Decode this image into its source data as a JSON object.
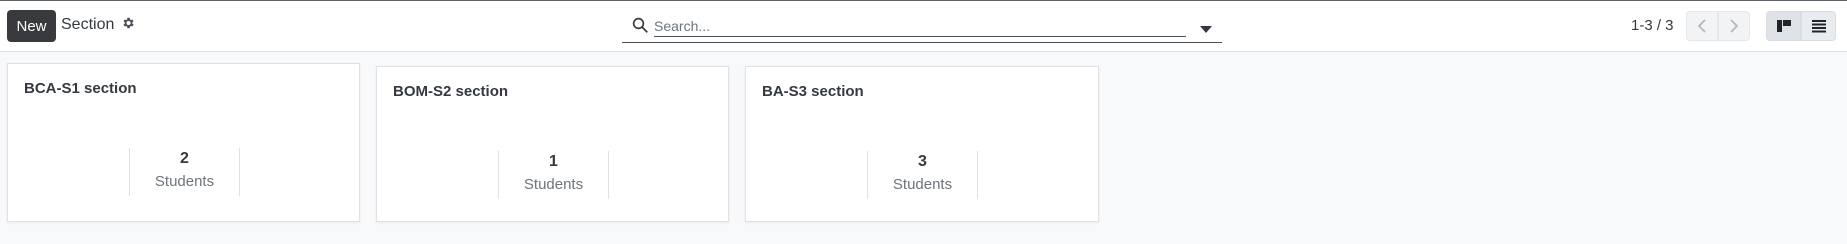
{
  "control_panel": {
    "new_button_label": "New",
    "breadcrumb": "Section",
    "settings_icon": "gear-icon",
    "search": {
      "placeholder": "Search...",
      "value": ""
    },
    "pager": {
      "value": "1-3 / 3"
    },
    "views": [
      "kanban",
      "list"
    ],
    "active_view": "kanban"
  },
  "sections": [
    {
      "title": "BCA-S1 section",
      "count": "2",
      "count_label": "Students"
    },
    {
      "title": "BOM-S2 section",
      "count": "1",
      "count_label": "Students"
    },
    {
      "title": "BA-S3 section",
      "count": "3",
      "count_label": "Students"
    }
  ],
  "colors": {
    "new_button": "#383a3d",
    "background": "#f8f9fa",
    "card": "#ffffff"
  }
}
